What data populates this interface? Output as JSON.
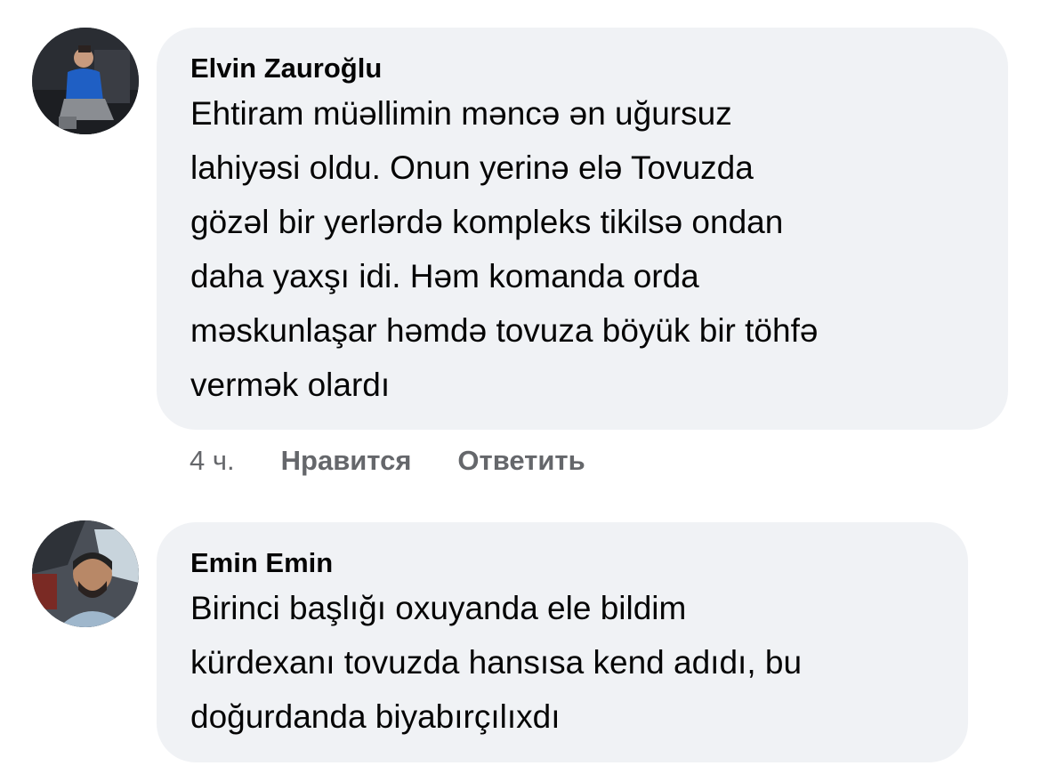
{
  "comments": [
    {
      "author": "Elvin Zauroğlu",
      "avatar_icon": "user-avatar-photo",
      "lines": [
        "Ehtiram müəllimin məncə ən uğursuz",
        "lahiyəsi oldu. Onun yerinə elə Tovuzda",
        "gözəl bir yerlərdə kompleks tikilsə ondan",
        "daha yaxşı idi. Həm komanda orda",
        "məskunlaşar həmdə tovuza böyük bir töhfə",
        "vermək olardı"
      ],
      "time": "4 ч.",
      "like_label": "Нравится",
      "reply_label": "Ответить"
    },
    {
      "author": "Emin Emin",
      "avatar_icon": "user-avatar-photo",
      "lines": [
        "Birinci başlığı oxuyanda ele bildim",
        "kürdexanı tovuzda hansısa kend adıdı, bu",
        "doğurdanda biyabırçılıxdı"
      ]
    }
  ],
  "colors": {
    "bubble_bg": "#f0f2f5",
    "text": "#050505",
    "meta_text": "#65676b"
  }
}
